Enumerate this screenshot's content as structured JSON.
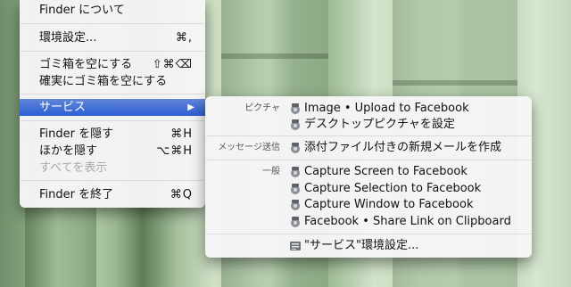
{
  "finder_menu": {
    "items": [
      {
        "label": "Finder について",
        "shortcut": ""
      },
      {
        "label": "環境設定...",
        "shortcut": "⌘,"
      },
      {
        "label": "ゴミ箱を空にする",
        "shortcut": "⇧⌘⌫"
      },
      {
        "label": "確実にゴミ箱を空にする",
        "shortcut": ""
      },
      {
        "label": "サービス",
        "shortcut": ""
      },
      {
        "label": "Finder を隠す",
        "shortcut": "⌘H"
      },
      {
        "label": "ほかを隠す",
        "shortcut": "⌥⌘H"
      },
      {
        "label": "すべてを表示",
        "shortcut": ""
      },
      {
        "label": "Finder を終了",
        "shortcut": "⌘Q"
      }
    ],
    "submenu_arrow": "▶"
  },
  "services_menu": {
    "categories": {
      "picture": "ピクチャ",
      "message": "メッセージ送信",
      "general": "一般"
    },
    "items": [
      {
        "label": "Image • Upload to Facebook",
        "icon": "automator-icon"
      },
      {
        "label": "デスクトップピクチャを設定",
        "icon": "automator-icon"
      },
      {
        "label": "添付ファイル付きの新規メールを作成",
        "icon": "automator-icon"
      },
      {
        "label": "Capture Screen to Facebook",
        "icon": "automator-icon"
      },
      {
        "label": "Capture Selection to Facebook",
        "icon": "automator-icon"
      },
      {
        "label": "Capture Window to Facebook",
        "icon": "automator-icon"
      },
      {
        "label": "Facebook • Share Link on Clipboard",
        "icon": "automator-icon"
      },
      {
        "label": "\"サービス\"環境設定...",
        "icon": "preferences-icon"
      }
    ]
  }
}
